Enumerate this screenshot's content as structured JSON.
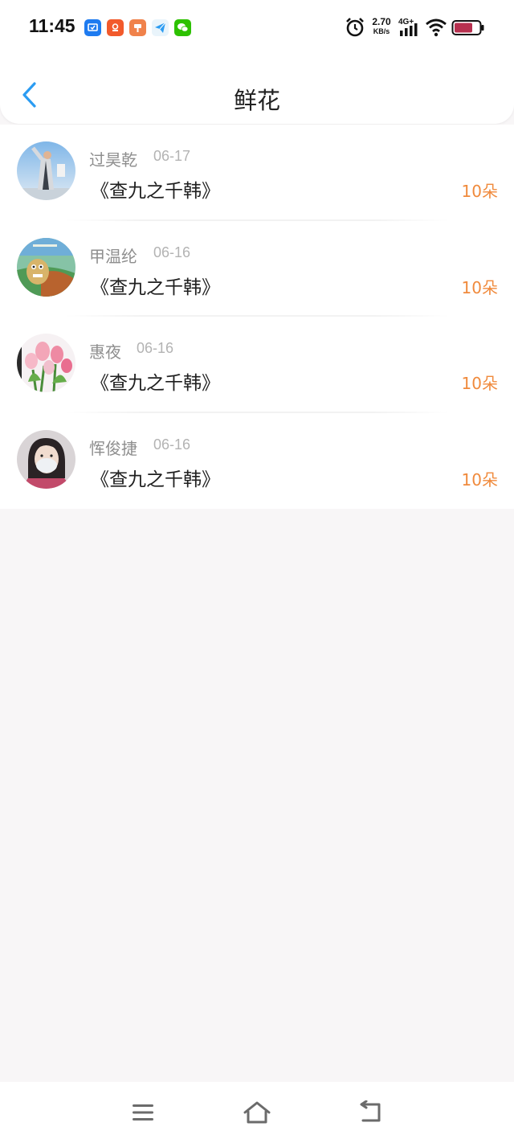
{
  "status_bar": {
    "time": "11:45",
    "net_speed_value": "2.70",
    "net_speed_unit": "KB/s",
    "network_type": "4G+",
    "app_icons": [
      "notification-app-icon",
      "pinduoduo-app-icon",
      "pin-app-icon",
      "telegram-app-icon",
      "wechat-app-icon"
    ],
    "status_icons": [
      "alarm-icon",
      "signal-icon",
      "wifi-icon",
      "battery-icon"
    ]
  },
  "header": {
    "title": "鲜花",
    "back_icon": "chevron-left-icon"
  },
  "colors": {
    "accent": "#2b9cf2",
    "amount": "#f08a3c",
    "name": "#8e8e8e",
    "date": "#b3b3b3"
  },
  "records": [
    {
      "name": "过昊乾",
      "date": "06-17",
      "work": "《查九之千韩》",
      "amount": "10朵"
    },
    {
      "name": "甲温纶",
      "date": "06-16",
      "work": "《查九之千韩》",
      "amount": "10朵"
    },
    {
      "name": "惠夜",
      "date": "06-16",
      "work": "《查九之千韩》",
      "amount": "10朵"
    },
    {
      "name": "恽俊捷",
      "date": "06-16",
      "work": "《查九之千韩》",
      "amount": "10朵"
    }
  ],
  "system_nav": {
    "icons": [
      "menu-icon",
      "home-icon",
      "back-icon"
    ]
  }
}
